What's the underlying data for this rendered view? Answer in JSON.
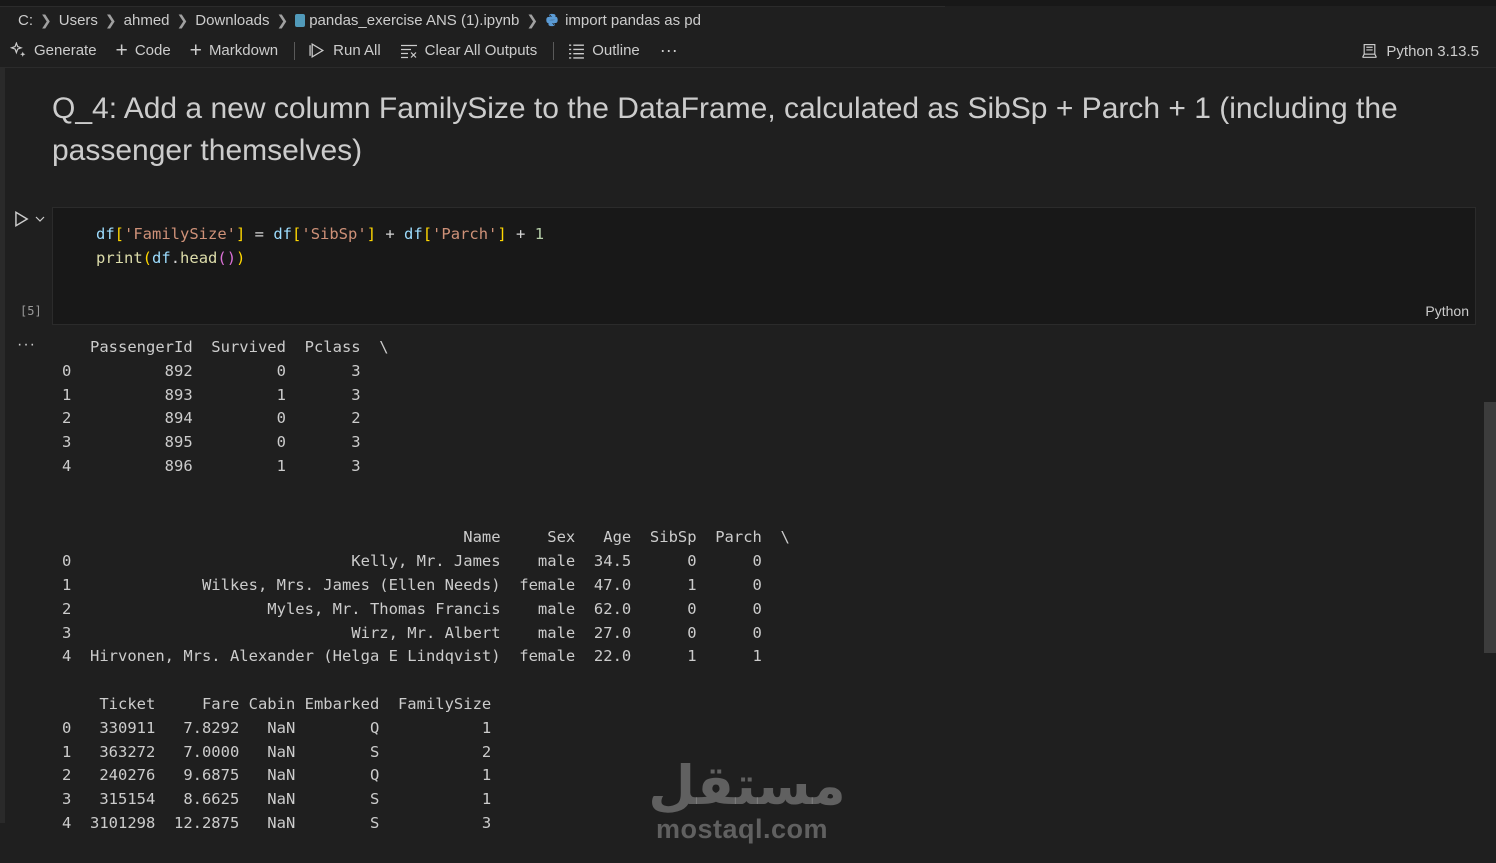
{
  "breadcrumb": {
    "items": [
      "C:",
      "Users",
      "ahmed",
      "Downloads"
    ],
    "file": "pandas_exercise ANS (1).ipynb",
    "cell_ref": "import pandas as pd"
  },
  "toolbar": {
    "generate": "Generate",
    "code": "Code",
    "markdown": "Markdown",
    "run_all": "Run All",
    "clear_outputs": "Clear All Outputs",
    "outline": "Outline",
    "more": "···",
    "kernel": "Python 3.13.5"
  },
  "markdown_cell": {
    "heading": "Q_4: Add a new column FamilySize to the DataFrame, calculated as SibSp + Parch + 1 (including the passenger themselves)"
  },
  "code_cell": {
    "execution_count": "[5]",
    "language": "Python",
    "line1": {
      "v1": "df",
      "b1": "[",
      "s1": "'FamilySize'",
      "b2": "]",
      "op1": " = ",
      "v2": "df",
      "b3": "[",
      "s2": "'SibSp'",
      "b4": "]",
      "op2": " + ",
      "v3": "df",
      "b5": "[",
      "s3": "'Parch'",
      "b6": "]",
      "op3": " + ",
      "n1": "1"
    },
    "line2": {
      "f1": "print",
      "p1": "(",
      "v1": "df",
      "dot": ".",
      "f2": "head",
      "p2": "()",
      "p3": ")"
    }
  },
  "output": {
    "more": "···",
    "text": "   PassengerId  Survived  Pclass  \\\n0          892         0       3   \n1          893         1       3   \n2          894         0       2   \n3          895         0       3   \n4          896         1       3   \n\n\n                                           Name     Sex   Age  SibSp  Parch  \\\n0                              Kelly, Mr. James    male  34.5      0      0   \n1              Wilkes, Mrs. James (Ellen Needs)  female  47.0      1      0   \n2                     Myles, Mr. Thomas Francis    male  62.0      0      0   \n3                              Wirz, Mr. Albert    male  27.0      0      0   \n4  Hirvonen, Mrs. Alexander (Helga E Lindqvist)  female  22.0      1      1   \n\n    Ticket     Fare Cabin Embarked  FamilySize  \n0   330911   7.8292   NaN        Q           1  \n1   363272   7.0000   NaN        S           2  \n2   240276   9.6875   NaN        Q           1  \n3   315154   8.6625   NaN        S           1  \n4  3101298  12.2875   NaN        S           3  "
  },
  "watermark": {
    "arabic": "مستقل",
    "latin": "mostaql.com"
  },
  "colors": {
    "background": "#1f1f1f",
    "cell_background": "#181818",
    "variable": "#9cdcfe",
    "string": "#ce9178",
    "bracket": "#ffd700",
    "function": "#dcdcaa"
  }
}
